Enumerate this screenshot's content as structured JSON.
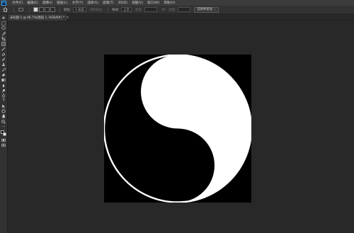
{
  "app": {
    "logo": "Ps"
  },
  "menu": [
    "文件(F)",
    "编辑(E)",
    "图像(I)",
    "图层(L)",
    "文字(Y)",
    "选择(S)",
    "滤镜(T)",
    "3D(D)",
    "视图(V)",
    "窗口(W)",
    "帮助(H)"
  ],
  "options": {
    "feather_label": "羽化:",
    "feather_value": "0 像素",
    "antialias_label": "消除锯齿",
    "style_label": "样式:",
    "style_value": "正常",
    "width_label": "宽度:",
    "height_label": "高度:",
    "select_subject": "选择并遮住 ..."
  },
  "document": {
    "tab_title": "未标题-1 @ 66.7%(图层 1, RGB/8#) *",
    "close": "×"
  },
  "icons": {
    "home": "home-icon",
    "marquee": "rectangle-marquee-icon",
    "canvas_shape": "yin-yang-icon"
  },
  "colors": {
    "canvas_bg": "#000000",
    "shape": "#ffffff",
    "workspace": "#282828"
  }
}
